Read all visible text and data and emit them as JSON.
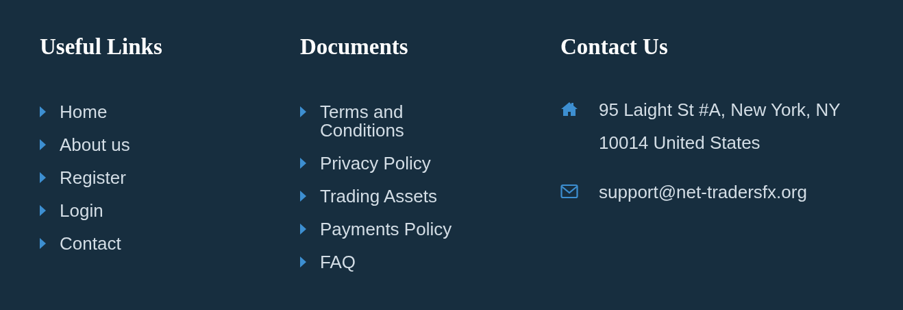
{
  "columns": [
    {
      "kind": "links",
      "title": "Useful Links",
      "items": [
        "Home",
        "About us",
        "Register",
        "Login",
        "Contact"
      ]
    },
    {
      "kind": "links",
      "title": "Documents",
      "items": [
        "Terms and Conditions",
        "Privacy Policy",
        "Trading Assets",
        "Payments Policy",
        "FAQ"
      ]
    },
    {
      "kind": "contact",
      "title": "Contact Us",
      "items": [
        {
          "kind": "address",
          "text": "95 Laight St #A, New York, NY 10014 United States"
        },
        {
          "kind": "email",
          "text": "support@net-tradersfx.org"
        }
      ]
    }
  ]
}
